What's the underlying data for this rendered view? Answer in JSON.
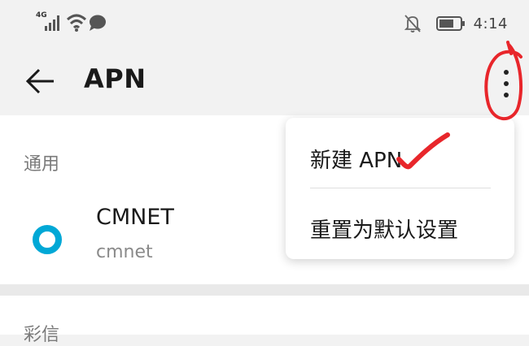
{
  "status_bar": {
    "network_label": "4G",
    "time": "4:14",
    "icons": [
      "signal-icon",
      "wifi-icon",
      "chat-bubble-icon",
      "bell-off-icon",
      "battery-icon"
    ]
  },
  "app_bar": {
    "title": "APN",
    "back_icon": "arrow-left-icon",
    "more_icon": "more-vertical-icon"
  },
  "general": {
    "section_label": "通用",
    "items": [
      {
        "name": "CMNET",
        "subtitle": "cmnet",
        "selected": true
      }
    ]
  },
  "mms": {
    "section_label": "彩信"
  },
  "menu": {
    "items": [
      {
        "label": "新建 APN"
      },
      {
        "label": "重置为默认设置"
      }
    ]
  },
  "colors": {
    "accent": "#00a8d6",
    "annotation": "#e8262b",
    "background": "#f2f2f2",
    "card": "#ffffff"
  }
}
